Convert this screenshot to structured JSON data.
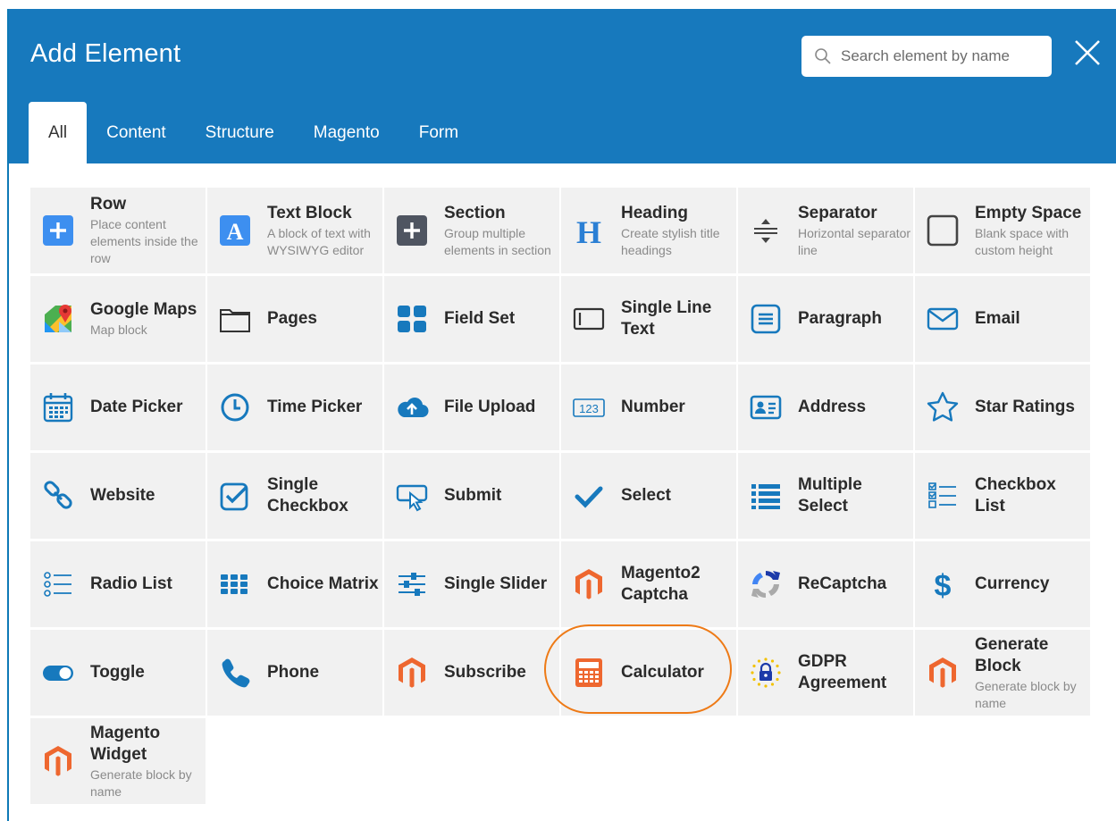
{
  "header": {
    "title": "Add Element",
    "search_placeholder": "Search element by name"
  },
  "tabs": [
    {
      "label": "All",
      "active": true
    },
    {
      "label": "Content",
      "active": false
    },
    {
      "label": "Structure",
      "active": false
    },
    {
      "label": "Magento",
      "active": false
    },
    {
      "label": "Form",
      "active": false
    }
  ],
  "colors": {
    "header_bg": "#1779bd",
    "tile_bg": "#f1f1f1",
    "highlight": "#ee7a16",
    "magento_orange": "#ee672f",
    "icon_blue": "#1779bd"
  },
  "elements": [
    [
      {
        "name": "Row",
        "desc": "Place content elements inside the row",
        "icon": "plus-square-icon"
      },
      {
        "name": "Text Block",
        "desc": "A block of text with WYSIWYG editor",
        "icon": "text-a-icon"
      },
      {
        "name": "Section",
        "desc": "Group multiple elements in section",
        "icon": "plus-dark-icon"
      },
      {
        "name": "Heading",
        "desc": "Create stylish title headings",
        "icon": "heading-h-icon"
      },
      {
        "name": "Separator",
        "desc": "Horizontal separator line",
        "icon": "separator-icon"
      },
      {
        "name": "Empty Space",
        "desc": "Blank space with custom height",
        "icon": "empty-square-icon"
      }
    ],
    [
      {
        "name": "Google Maps",
        "desc": "Map block",
        "icon": "google-maps-icon"
      },
      {
        "name": "Pages",
        "desc": "",
        "icon": "folder-tab-icon"
      },
      {
        "name": "Field Set",
        "desc": "",
        "icon": "grid-squares-icon"
      },
      {
        "name": "Single Line Text",
        "desc": "",
        "icon": "text-field-icon"
      },
      {
        "name": "Paragraph",
        "desc": "",
        "icon": "paragraph-icon"
      },
      {
        "name": "Email",
        "desc": "",
        "icon": "envelope-icon"
      }
    ],
    [
      {
        "name": "Date Picker",
        "desc": "",
        "icon": "calendar-icon"
      },
      {
        "name": "Time Picker",
        "desc": "",
        "icon": "clock-icon"
      },
      {
        "name": "File Upload",
        "desc": "",
        "icon": "cloud-upload-icon"
      },
      {
        "name": "Number",
        "desc": "",
        "icon": "number-123-icon"
      },
      {
        "name": "Address",
        "desc": "",
        "icon": "address-card-icon"
      },
      {
        "name": "Star Ratings",
        "desc": "",
        "icon": "star-icon"
      }
    ],
    [
      {
        "name": "Website",
        "desc": "",
        "icon": "link-icon"
      },
      {
        "name": "Single Checkbox",
        "desc": "",
        "icon": "checkbox-icon"
      },
      {
        "name": "Submit",
        "desc": "",
        "icon": "submit-cursor-icon"
      },
      {
        "name": "Select",
        "desc": "",
        "icon": "checkmark-icon"
      },
      {
        "name": "Multiple Select",
        "desc": "",
        "icon": "list-icon"
      },
      {
        "name": "Checkbox List",
        "desc": "",
        "icon": "checkbox-list-icon"
      }
    ],
    [
      {
        "name": "Radio List",
        "desc": "",
        "icon": "radio-list-icon"
      },
      {
        "name": "Choice Matrix",
        "desc": "",
        "icon": "matrix-icon"
      },
      {
        "name": "Single Slider",
        "desc": "",
        "icon": "sliders-icon"
      },
      {
        "name": "Magento2 Captcha",
        "desc": "",
        "icon": "magento-icon"
      },
      {
        "name": "ReCaptcha",
        "desc": "",
        "icon": "recaptcha-icon"
      },
      {
        "name": "Currency",
        "desc": "",
        "icon": "dollar-icon"
      }
    ],
    [
      {
        "name": "Toggle",
        "desc": "",
        "icon": "toggle-icon"
      },
      {
        "name": "Phone",
        "desc": "",
        "icon": "phone-icon"
      },
      {
        "name": "Subscribe",
        "desc": "",
        "icon": "magento-icon"
      },
      {
        "name": "Calculator",
        "desc": "",
        "icon": "calculator-icon",
        "highlighted": true
      },
      {
        "name": "GDPR Agreement",
        "desc": "",
        "icon": "gdpr-lock-icon"
      },
      {
        "name": "Generate Block",
        "desc": "Generate block by name",
        "icon": "magento-icon"
      }
    ],
    [
      {
        "name": "Magento Widget",
        "desc": "Generate block by name",
        "icon": "magento-icon"
      }
    ]
  ]
}
